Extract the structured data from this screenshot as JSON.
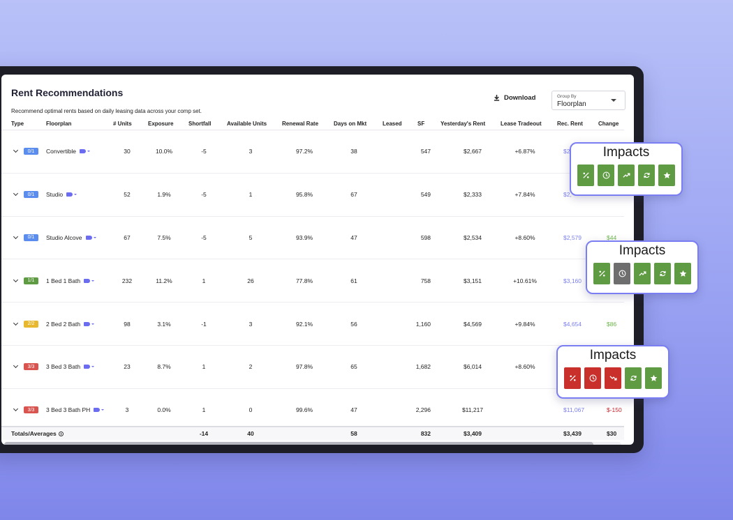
{
  "header": {
    "title": "Rent Recommendations",
    "subtitle": "Recommend optimal rents based on daily leasing data across your comp set.",
    "download_label": "Download",
    "group_by_label": "Group By",
    "group_by_value": "Floorplan"
  },
  "columns": {
    "type": "Type",
    "floorplan": "Floorplan",
    "units": "# Units",
    "exposure": "Exposure",
    "shortfall": "Shortfall",
    "available": "Available Units",
    "renewal": "Renewal Rate",
    "days": "Days on Mkt",
    "leased": "Leased",
    "sf": "SF",
    "yesterday": "Yesterday's Rent",
    "tradeout": "Lease Tradeout",
    "rec": "Rec. Rent",
    "change": "Change"
  },
  "rows": [
    {
      "type": "0/1",
      "type_color": "#5b8def",
      "floorplan": "Convertible",
      "units": "30",
      "exposure": "10.0%",
      "shortfall": "-5",
      "available": "3",
      "renewal": "97.2%",
      "days": "38",
      "sf": "547",
      "yesterday": "$2,667",
      "tradeout": "+6.87%",
      "rec": "$2",
      "change": ""
    },
    {
      "type": "0/1",
      "type_color": "#5b8def",
      "floorplan": "Studio",
      "units": "52",
      "exposure": "1.9%",
      "shortfall": "-5",
      "available": "1",
      "renewal": "95.8%",
      "days": "67",
      "sf": "549",
      "yesterday": "$2,333",
      "tradeout": "+7.84%",
      "rec": "$2,",
      "change": ""
    },
    {
      "type": "0/1",
      "type_color": "#5b8def",
      "floorplan": "Studio Alcove",
      "units": "67",
      "exposure": "7.5%",
      "shortfall": "-5",
      "available": "5",
      "renewal": "93.9%",
      "days": "47",
      "sf": "598",
      "yesterday": "$2,534",
      "tradeout": "+8.60%",
      "rec": "$2,579",
      "change": "$44"
    },
    {
      "type": "1/1",
      "type_color": "#5e9b42",
      "floorplan": "1 Bed 1 Bath",
      "units": "232",
      "exposure": "11.2%",
      "shortfall": "1",
      "available": "26",
      "renewal": "77.8%",
      "days": "61",
      "sf": "758",
      "yesterday": "$3,151",
      "tradeout": "+10.61%",
      "rec": "$3,160",
      "change": ""
    },
    {
      "type": "2/2",
      "type_color": "#e8b92e",
      "floorplan": "2 Bed 2 Bath",
      "units": "98",
      "exposure": "3.1%",
      "shortfall": "-1",
      "available": "3",
      "renewal": "92.1%",
      "days": "56",
      "sf": "1,160",
      "yesterday": "$4,569",
      "tradeout": "+9.84%",
      "rec": "$4,654",
      "change": "$86"
    },
    {
      "type": "3/3",
      "type_color": "#d9534f",
      "floorplan": "3 Bed 3 Bath",
      "units": "23",
      "exposure": "8.7%",
      "shortfall": "1",
      "available": "2",
      "renewal": "97.8%",
      "days": "65",
      "sf": "1,682",
      "yesterday": "$6,014",
      "tradeout": "+8.60%",
      "rec": "",
      "change": ""
    },
    {
      "type": "3/3",
      "type_color": "#d9534f",
      "floorplan": "3 Bed 3 Bath PH",
      "units": "3",
      "exposure": "0.0%",
      "shortfall": "1",
      "available": "0",
      "renewal": "99.6%",
      "days": "47",
      "sf": "2,296",
      "yesterday": "$11,217",
      "tradeout": "",
      "rec": "$11,067",
      "change": "$-150"
    }
  ],
  "totals": {
    "label": "Totals/Averages",
    "shortfall": "-14",
    "available": "40",
    "days": "58",
    "sf": "832",
    "yesterday": "$3,409",
    "rec": "$3,439",
    "change": "$30"
  },
  "popups": [
    {
      "title": "Impacts",
      "icons": [
        "percent-icon",
        "clock-icon",
        "trend-up-icon",
        "refresh-icon",
        "star-icon"
      ],
      "colors": [
        "#5e9b42",
        "#5e9b42",
        "#5e9b42",
        "#5e9b42",
        "#5e9b42"
      ]
    },
    {
      "title": "Impacts",
      "icons": [
        "percent-icon",
        "clock-icon",
        "trend-up-icon",
        "refresh-icon",
        "star-icon"
      ],
      "colors": [
        "#5e9b42",
        "#6e6e6e",
        "#5e9b42",
        "#5e9b42",
        "#5e9b42"
      ]
    },
    {
      "title": "Impacts",
      "icons": [
        "percent-icon",
        "clock-icon",
        "trend-down-icon",
        "refresh-icon",
        "star-icon"
      ],
      "colors": [
        "#c9302c",
        "#c9302c",
        "#c9302c",
        "#5e9b42",
        "#5e9b42"
      ]
    }
  ]
}
